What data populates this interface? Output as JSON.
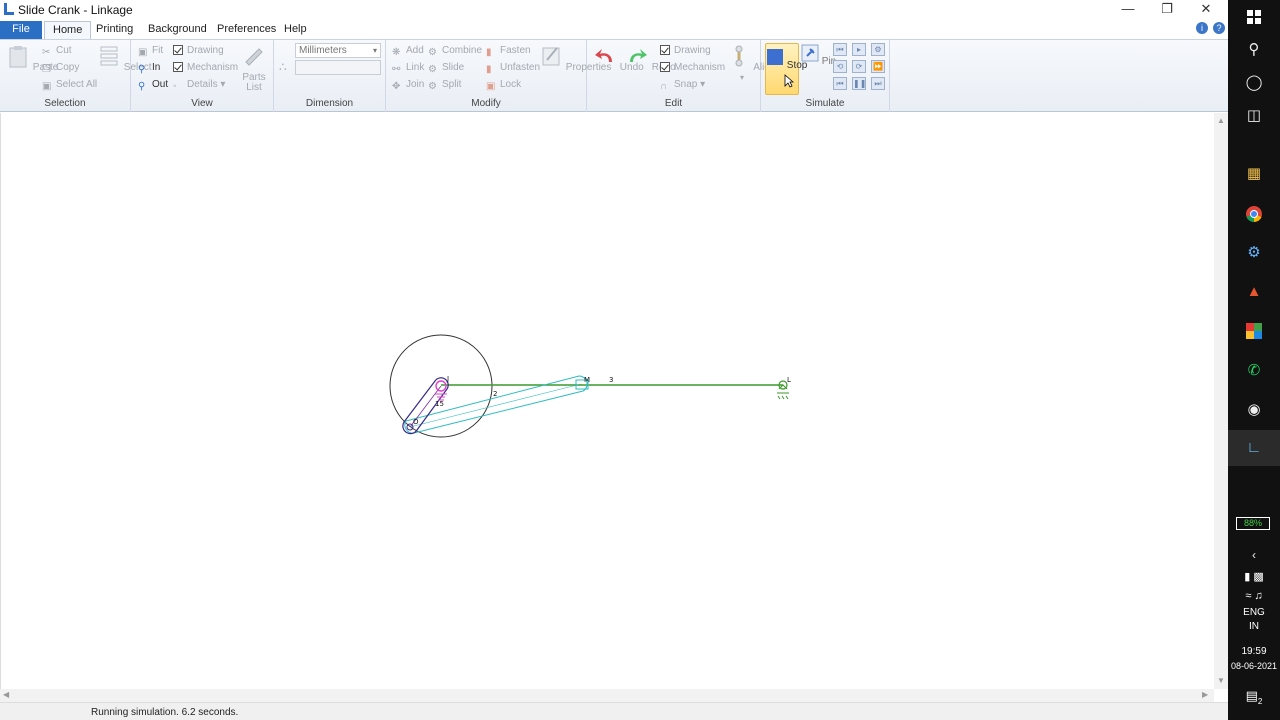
{
  "window": {
    "title": "Slide Crank - Linkage"
  },
  "menu": {
    "file": "File",
    "tabs": [
      "Home",
      "Printing",
      "Background",
      "Preferences",
      "Help"
    ]
  },
  "ribbon": {
    "selection": {
      "label": "Selection",
      "paste": "Paste",
      "cut": "Cut",
      "copy": "Copy",
      "select_all": "Select All",
      "select": "Select"
    },
    "view": {
      "label": "View",
      "fit": "Fit",
      "in": "In",
      "out": "Out",
      "drawing": "Drawing",
      "mechanism": "Mechanism",
      "details": "Details",
      "parts_list": "Parts List"
    },
    "dimension": {
      "label": "Dimension",
      "units": "Millimeters"
    },
    "modify": {
      "label": "Modify",
      "add": "Add",
      "link": "Link",
      "join": "Join",
      "combine": "Combine",
      "slide": "Slide",
      "split": "Split",
      "fasten": "Fasten",
      "unfasten": "Unfasten",
      "lock": "Lock",
      "properties": "Properties"
    },
    "edit": {
      "label": "Edit",
      "undo": "Undo",
      "redo": "Redo",
      "drawing": "Drawing",
      "mechanism": "Mechanism",
      "snap": "Snap",
      "align": "Align"
    },
    "simulate": {
      "label": "Simulate",
      "stop": "Stop",
      "pin": "Pin"
    }
  },
  "mechanism": {
    "labels": {
      "j": "J",
      "m": "M",
      "l": "L",
      "o": "O",
      "link2": "2",
      "link3": "3",
      "link15": "15"
    }
  },
  "status": {
    "text": "Running simulation. 6.2 seconds."
  },
  "taskbar": {
    "battery": "88%",
    "lang1": "ENG",
    "lang2": "IN",
    "time": "19:59",
    "date": "08-06-2021",
    "notifications": "2"
  },
  "colors": {
    "accent": "#2b6fc4",
    "crank": "#7a2aa8",
    "connecting_rod": "#2fbcc0",
    "ground_line": "#3a9a2a",
    "pin_highlight": "#e040d0"
  }
}
